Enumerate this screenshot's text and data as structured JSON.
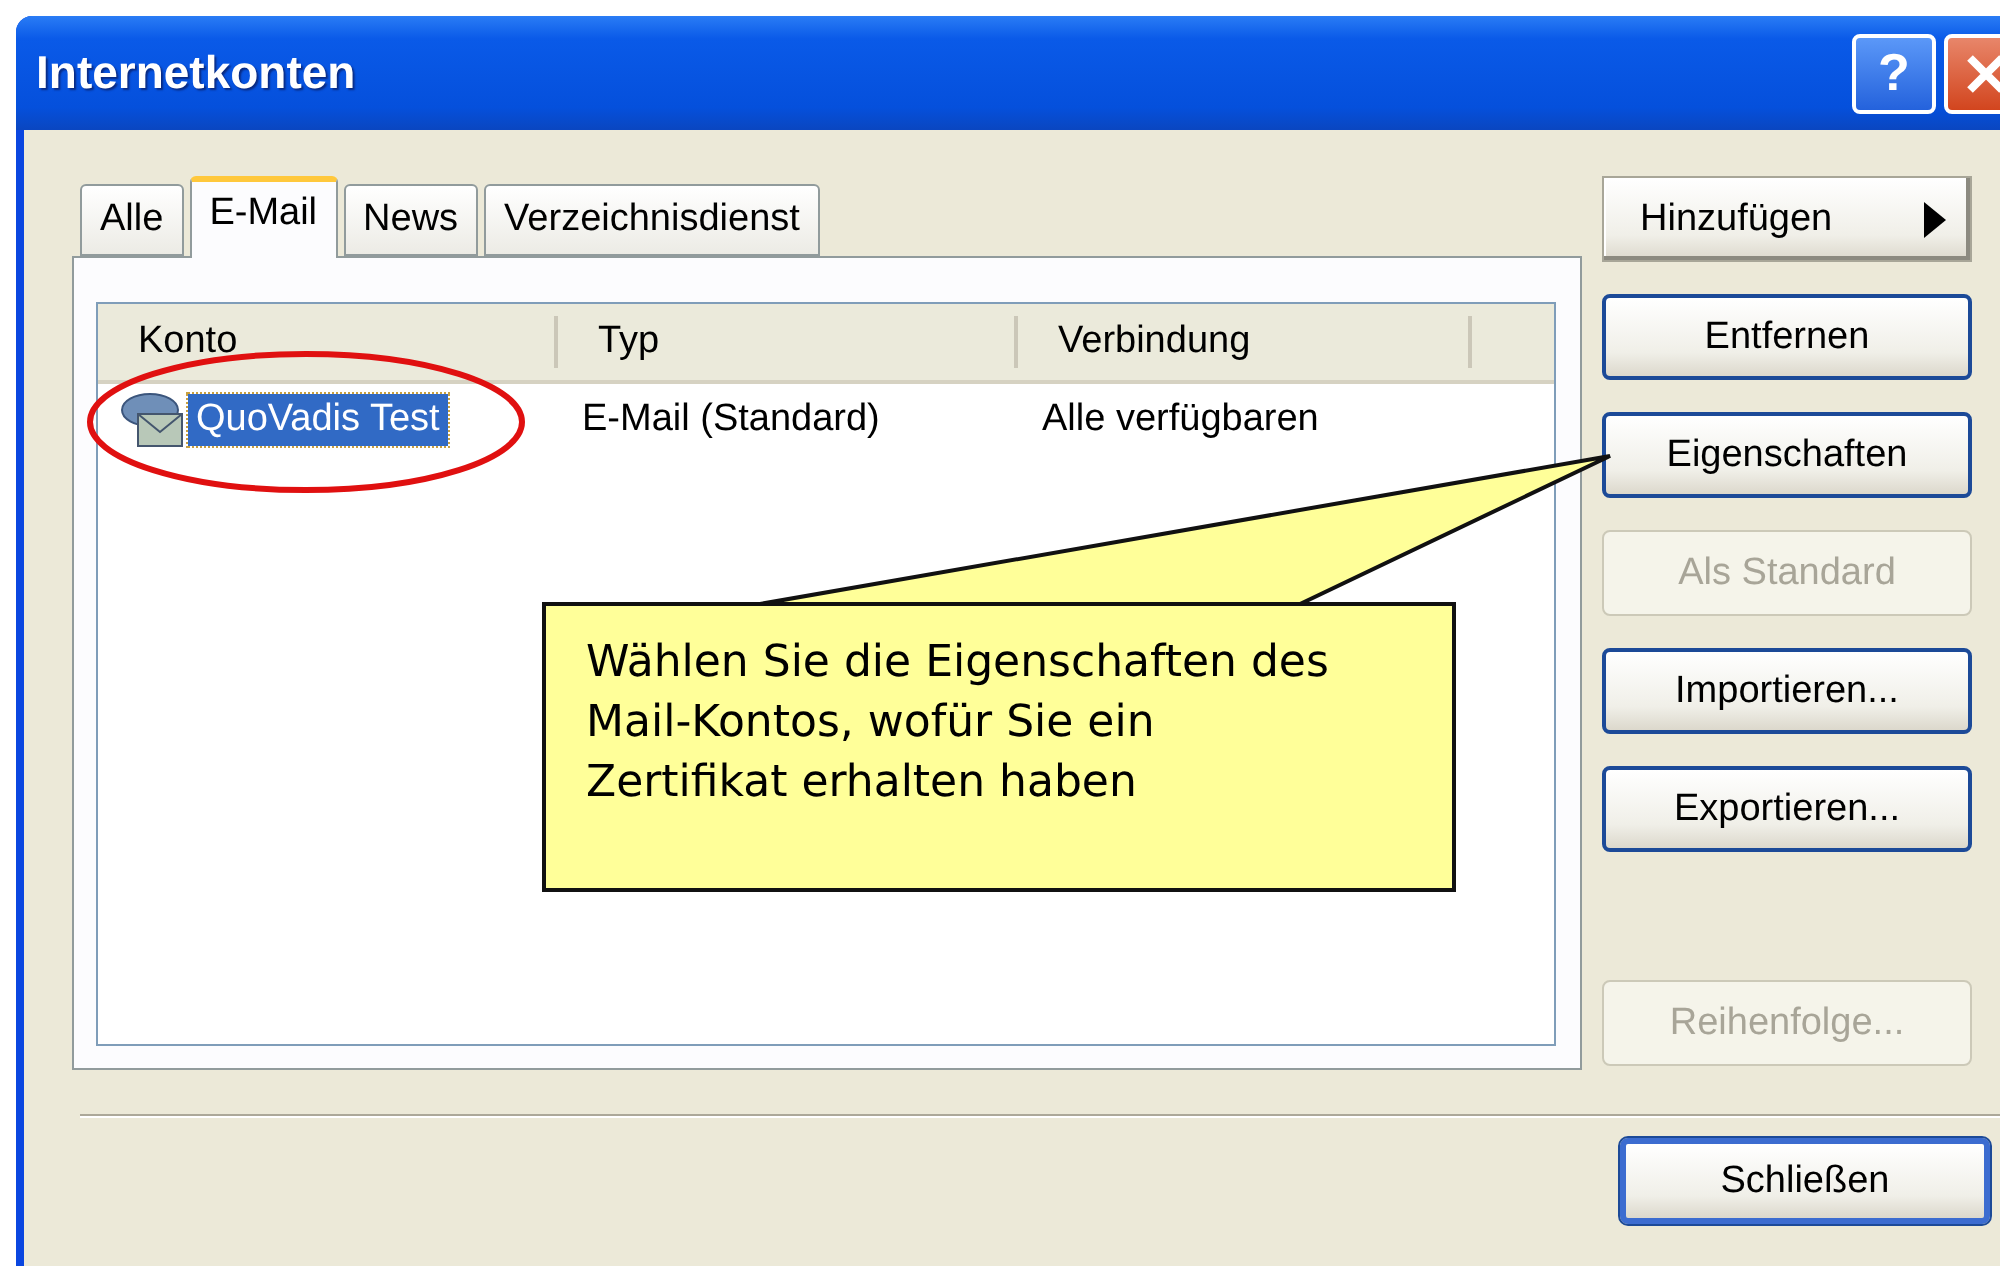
{
  "window": {
    "title": "Internetkonten",
    "title_buttons": [
      {
        "kind": "help",
        "label": "?"
      },
      {
        "kind": "close"
      }
    ]
  },
  "tabs": [
    {
      "label": "Alle",
      "selected": false
    },
    {
      "label": "E-Mail",
      "selected": true
    },
    {
      "label": "News",
      "selected": false
    },
    {
      "label": "Verzeichnisdienst",
      "selected": false
    }
  ],
  "list": {
    "columns": [
      "Konto",
      "Typ",
      "Verbindung"
    ],
    "rows": [
      {
        "cells": [
          "QuoVadis Test",
          "E-Mail (Standard)",
          "Alle verfügbaren"
        ],
        "selected": true
      }
    ]
  },
  "buttons": [
    {
      "label": "Hinzufügen",
      "kind": "menu",
      "disabled": false
    },
    {
      "label": "Entfernen",
      "kind": "plain",
      "disabled": false
    },
    {
      "label": "Eigenschaften",
      "kind": "plain",
      "disabled": false
    },
    {
      "label": "Als Standard",
      "kind": "plain",
      "disabled": true
    },
    {
      "label": "Importieren...",
      "kind": "plain",
      "disabled": false
    },
    {
      "label": "Exportieren...",
      "kind": "plain",
      "disabled": false
    },
    {
      "label": "Reihenfolge...",
      "kind": "plain",
      "disabled": true
    }
  ],
  "close_button": {
    "label": "Schließen"
  },
  "callout": {
    "text": "Wählen Sie die Eigenschaften des Mail-Kontos, wofür Sie ein Zertifikat erhalten haben"
  }
}
